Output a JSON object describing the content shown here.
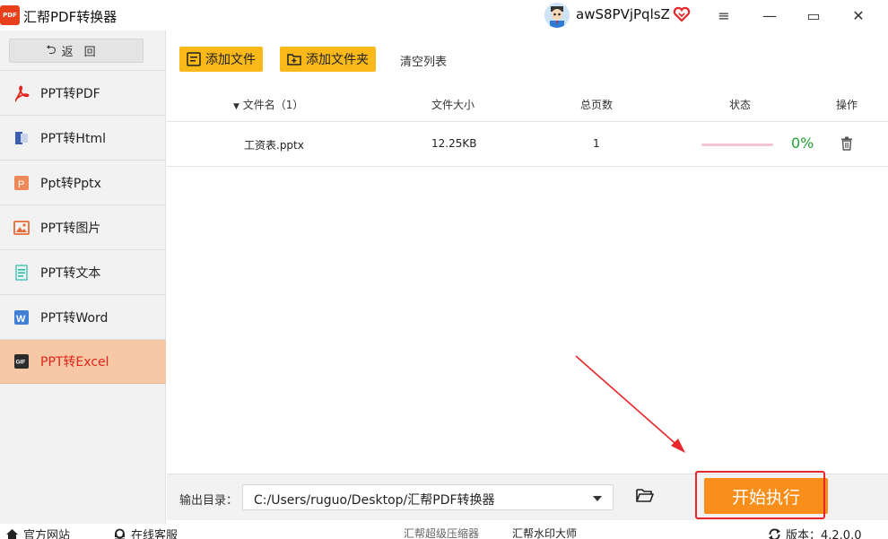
{
  "app": {
    "logo_text": "PDF",
    "title": "汇帮PDF转换器"
  },
  "user": {
    "name": "awS8PVjPqlsZ"
  },
  "window_controls": {
    "menu": "≡",
    "minimize": "—",
    "maximize": "▭",
    "close": "✕"
  },
  "sidebar": {
    "back_arrow": "⮌",
    "back_label": "返回",
    "items": [
      {
        "label": "PPT转PDF",
        "icon": "pdf-icon"
      },
      {
        "label": "PPT转Html",
        "icon": "html-icon"
      },
      {
        "label": "Ppt转Pptx",
        "icon": "pptx-icon"
      },
      {
        "label": "PPT转图片",
        "icon": "image-icon"
      },
      {
        "label": "PPT转文本",
        "icon": "text-icon"
      },
      {
        "label": "PPT转Word",
        "icon": "word-icon"
      },
      {
        "label": "PPT转Excel",
        "icon": "gif-icon",
        "active": true
      }
    ]
  },
  "toolbar": {
    "add_file": "添加文件",
    "add_folder": "添加文件夹",
    "clear_list": "清空列表"
  },
  "table": {
    "headers": {
      "name": "文件名（1）",
      "size": "文件大小",
      "pages": "总页数",
      "status": "状态",
      "ops": "操作"
    },
    "rows": [
      {
        "name": "工资表.pptx",
        "size": "12.25KB",
        "pages": "1",
        "progress": "0%"
      }
    ]
  },
  "output": {
    "label": "输出目录：",
    "path": "C:/Users/ruguo/Desktop/汇帮PDF转换器"
  },
  "start_button": "开始执行",
  "footer": {
    "official_site": "官方网站",
    "online_service": "在线客服",
    "link_compressor": "汇帮超级压缩器",
    "link_watermark": "汇帮水印大师",
    "version": "版本：4.2.0.0"
  },
  "colors": {
    "accent_orange": "#f98f1a",
    "toolbar_yellow": "#f9b919",
    "active_bg": "#f7c8a6",
    "active_text": "#e2231a",
    "progress_green": "#1fa331",
    "annotation_red": "#e8262b"
  }
}
